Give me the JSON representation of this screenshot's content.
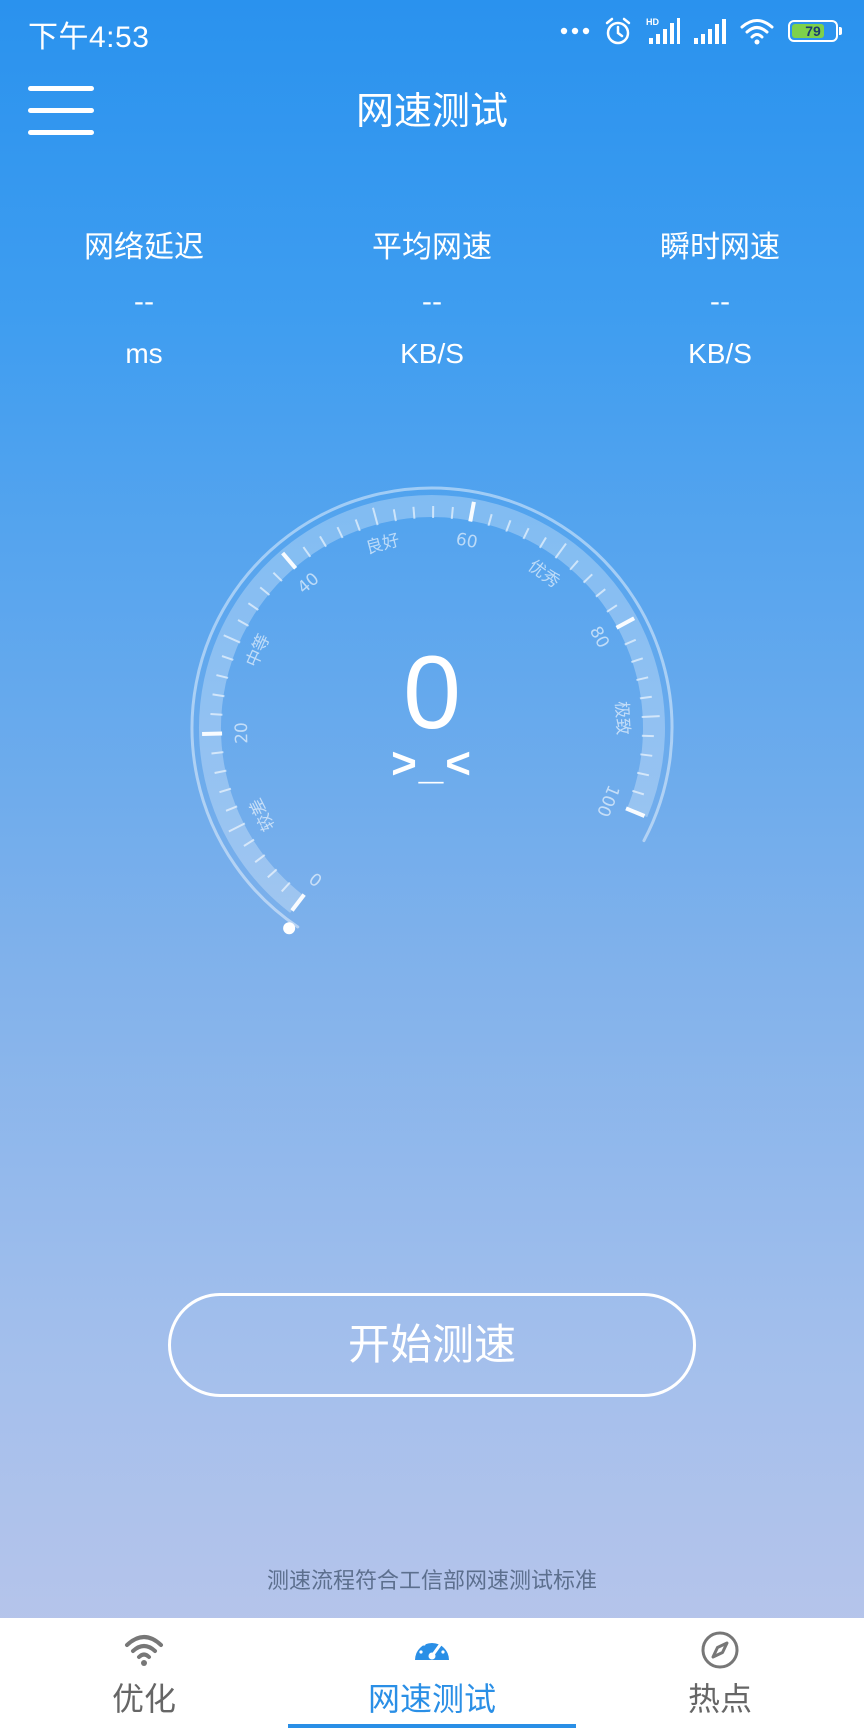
{
  "status_bar": {
    "time": "下午4:53",
    "battery_level": "79",
    "battery_fraction": 0.79,
    "icons": [
      "more-dots-icon",
      "alarm-icon",
      "hd-signal-icon",
      "signal-icon",
      "wifi-icon",
      "battery-icon"
    ]
  },
  "header": {
    "title": "网速测试",
    "menu_icon": "hamburger-menu-icon"
  },
  "stats": [
    {
      "label": "网络延迟",
      "value": "--",
      "unit": "ms"
    },
    {
      "label": "平均网速",
      "value": "--",
      "unit": "KB/S"
    },
    {
      "label": "瞬时网速",
      "value": "--",
      "unit": "KB/S"
    }
  ],
  "gauge": {
    "value": "0",
    "current_fraction": 0,
    "face": ">_<",
    "min": 0,
    "max": 100,
    "tick_labels": [
      {
        "value": 0,
        "text": "0"
      },
      {
        "value": 20,
        "text": "20"
      },
      {
        "value": 40,
        "text": "40"
      },
      {
        "value": 60,
        "text": "60"
      },
      {
        "value": 80,
        "text": "80"
      },
      {
        "value": 100,
        "text": "100"
      }
    ],
    "zone_labels": [
      {
        "value": 10,
        "text": "较差"
      },
      {
        "value": 30,
        "text": "中等"
      },
      {
        "value": 50,
        "text": "良好"
      },
      {
        "value": 70,
        "text": "优秀"
      },
      {
        "value": 90,
        "text": "极致"
      }
    ]
  },
  "start_button": {
    "label": "开始测速"
  },
  "footnote": "测速流程符合工信部网速测试标准",
  "nav": [
    {
      "label": "优化",
      "icon": "wifi-icon",
      "active": false
    },
    {
      "label": "网速测试",
      "icon": "speedometer-icon",
      "active": true
    },
    {
      "label": "热点",
      "icon": "compass-icon",
      "active": false
    }
  ],
  "colors": {
    "accent": "#2a8fe6",
    "battery_fill": "#7ed14a",
    "nav_inactive": "#666666",
    "footnote": "#5c6f8e"
  }
}
